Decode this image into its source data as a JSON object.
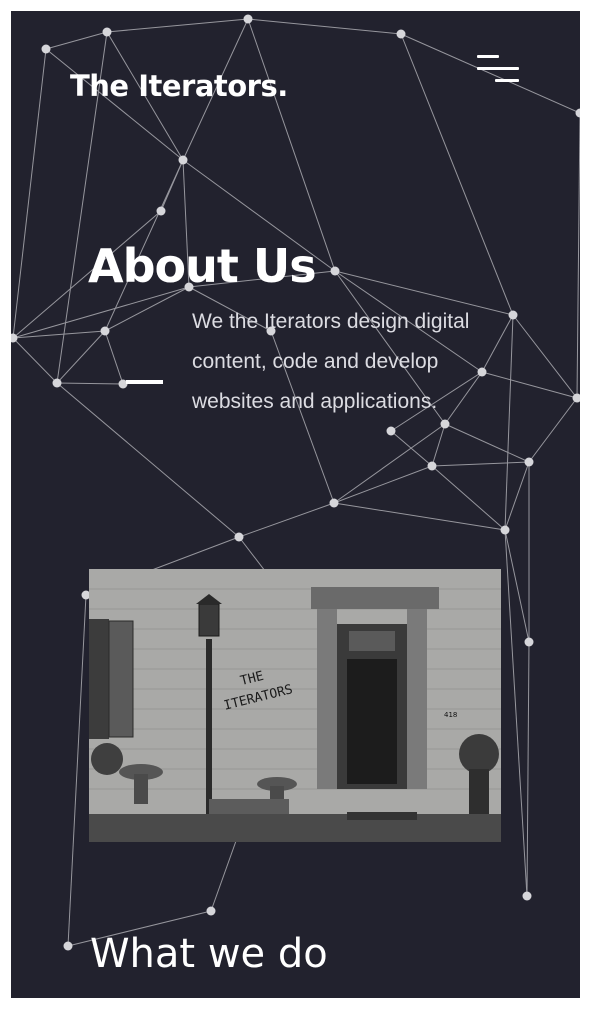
{
  "brand": {
    "name": "The Iterators."
  },
  "header": {
    "menu_icon": "hamburger-menu-icon"
  },
  "about": {
    "title": "About Us",
    "description": "We the Iterators design digital content, code and develop websites and applications."
  },
  "photo": {
    "sign_line1": "THE",
    "sign_line2": "ITERATORS",
    "house_number": "418"
  },
  "section": {
    "title": "What we do"
  },
  "colors": {
    "background": "#22222e",
    "text": "#ffffff",
    "network": "#c8c8cc"
  }
}
